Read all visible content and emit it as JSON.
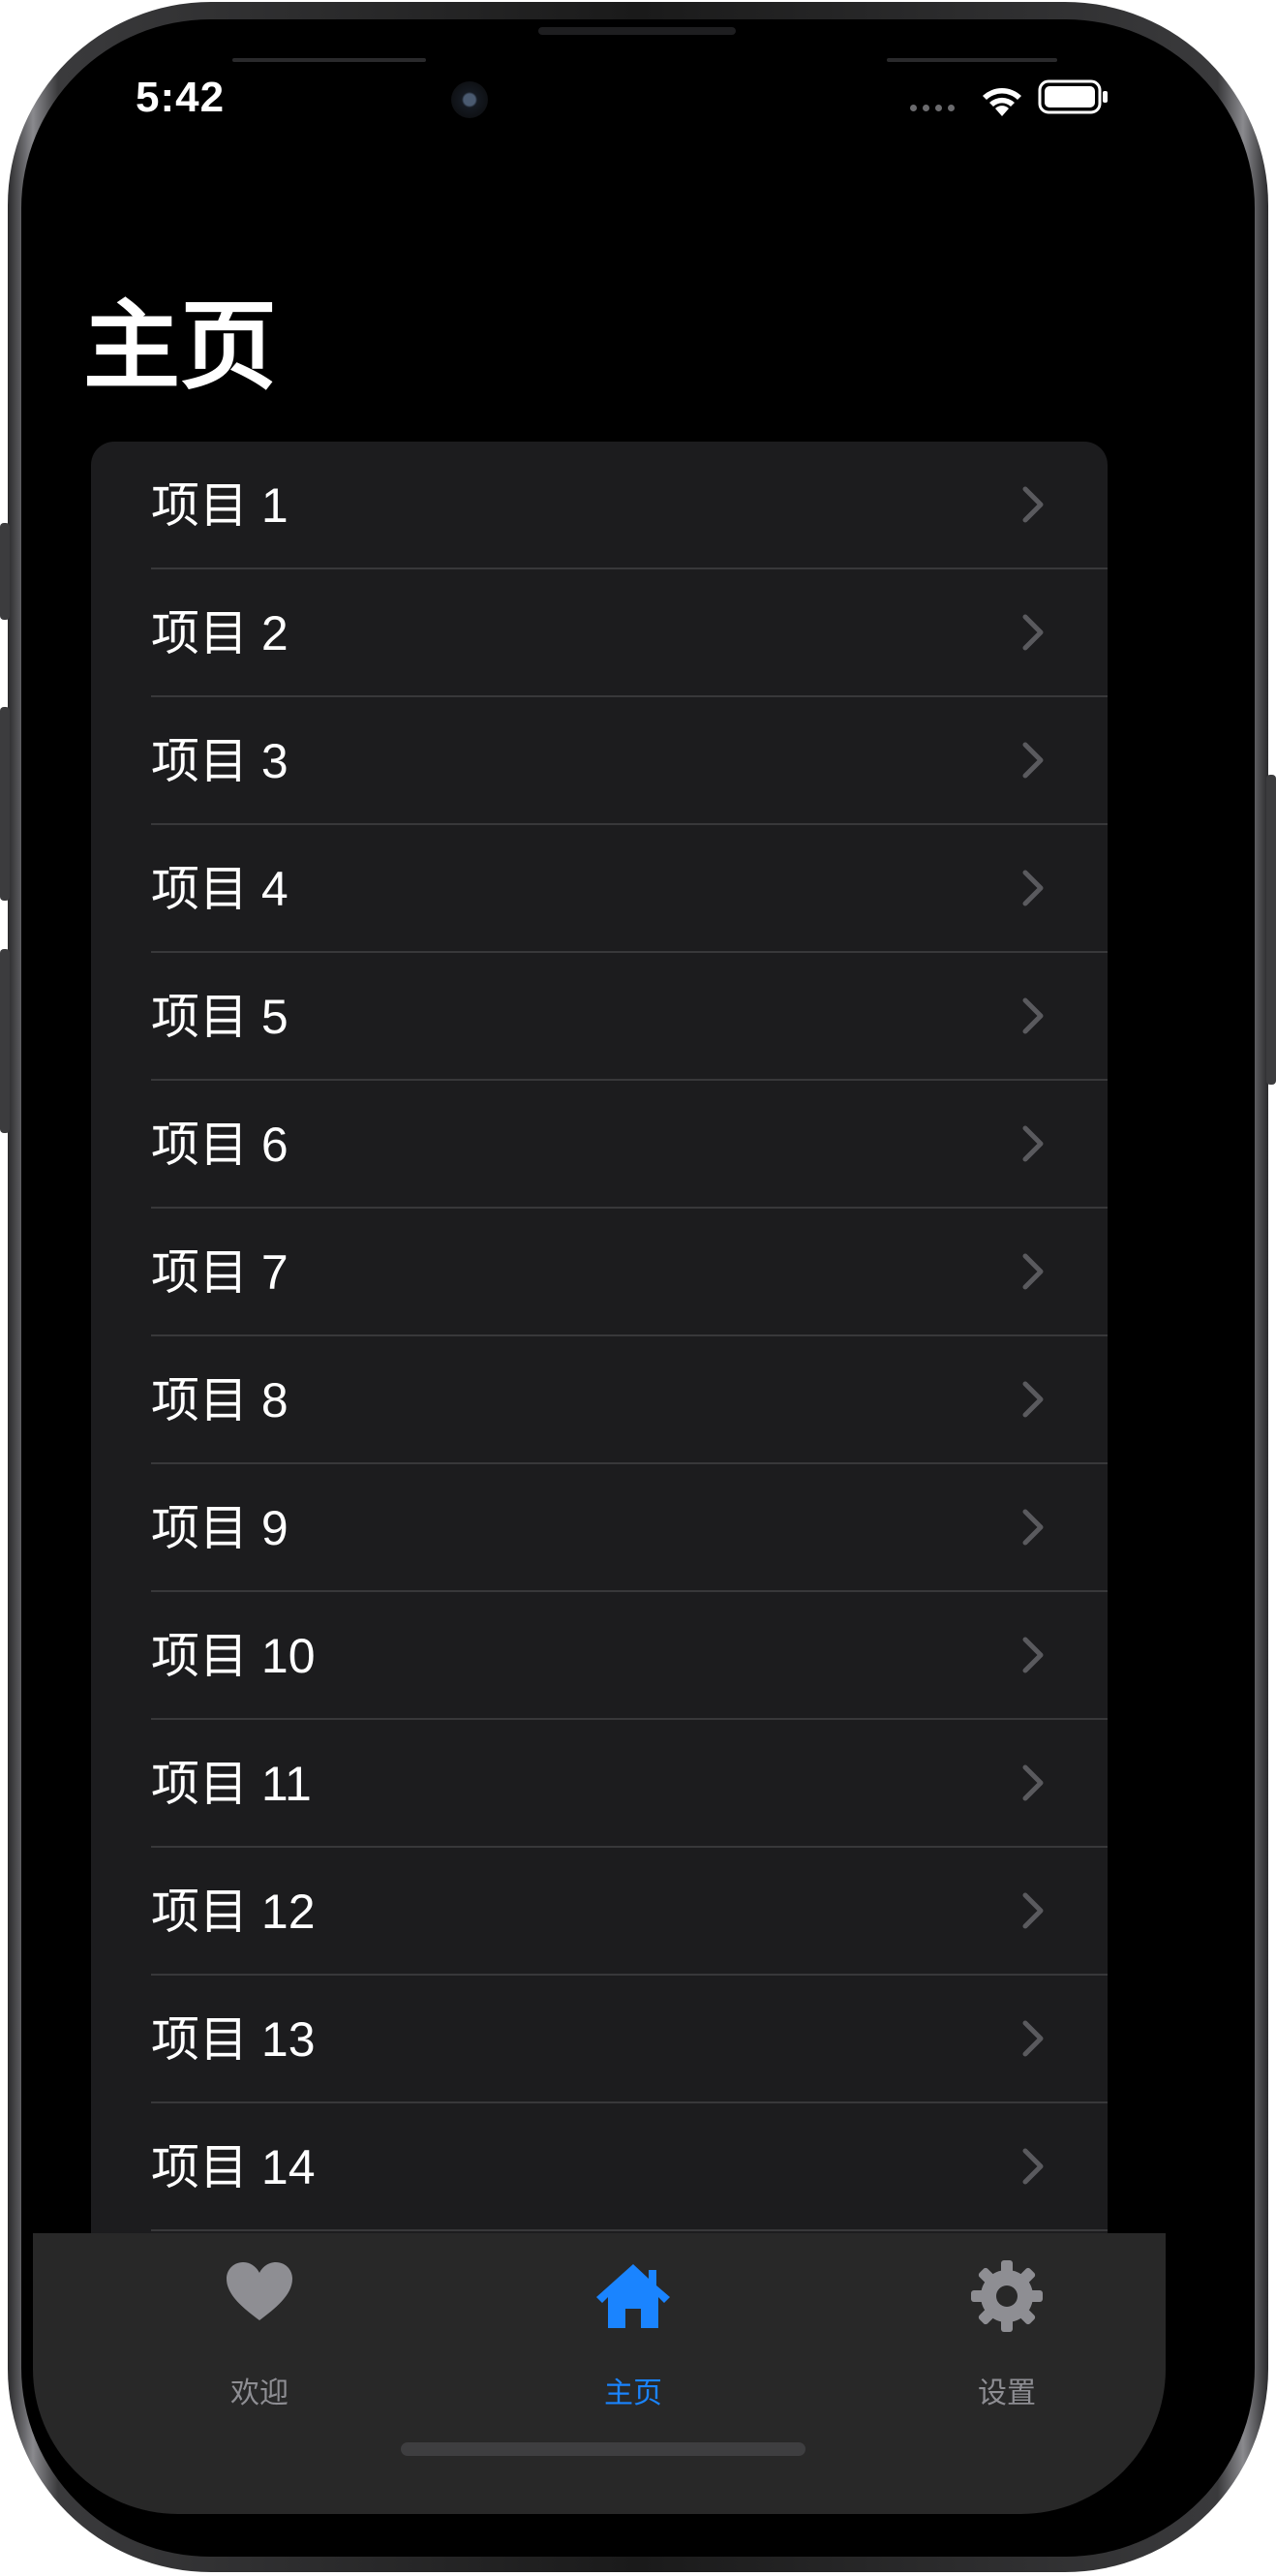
{
  "status_bar": {
    "time": "5:42",
    "icons": [
      "signal-dots-icon",
      "wifi-icon",
      "battery-icon"
    ]
  },
  "navigation": {
    "title": "主页"
  },
  "list": {
    "items": [
      {
        "label": "项目 1"
      },
      {
        "label": "项目 2"
      },
      {
        "label": "项目 3"
      },
      {
        "label": "项目 4"
      },
      {
        "label": "项目 5"
      },
      {
        "label": "项目 6"
      },
      {
        "label": "项目 7"
      },
      {
        "label": "项目 8"
      },
      {
        "label": "项目 9"
      },
      {
        "label": "项目 10"
      },
      {
        "label": "项目 11"
      },
      {
        "label": "项目 12"
      },
      {
        "label": "项目 13"
      },
      {
        "label": "项目 14"
      }
    ]
  },
  "tab_bar": {
    "tabs": [
      {
        "label": "欢迎",
        "icon": "heart-icon",
        "selected": false
      },
      {
        "label": "主页",
        "icon": "house-icon",
        "selected": true
      },
      {
        "label": "设置",
        "icon": "gear-icon",
        "selected": false
      }
    ]
  },
  "colors": {
    "accent": "#1a84ff",
    "inactive": "#8e8e93",
    "background": "#000000",
    "list_background": "#1c1c1e",
    "separator": "#38383a",
    "tab_bar_background": "#282828"
  }
}
